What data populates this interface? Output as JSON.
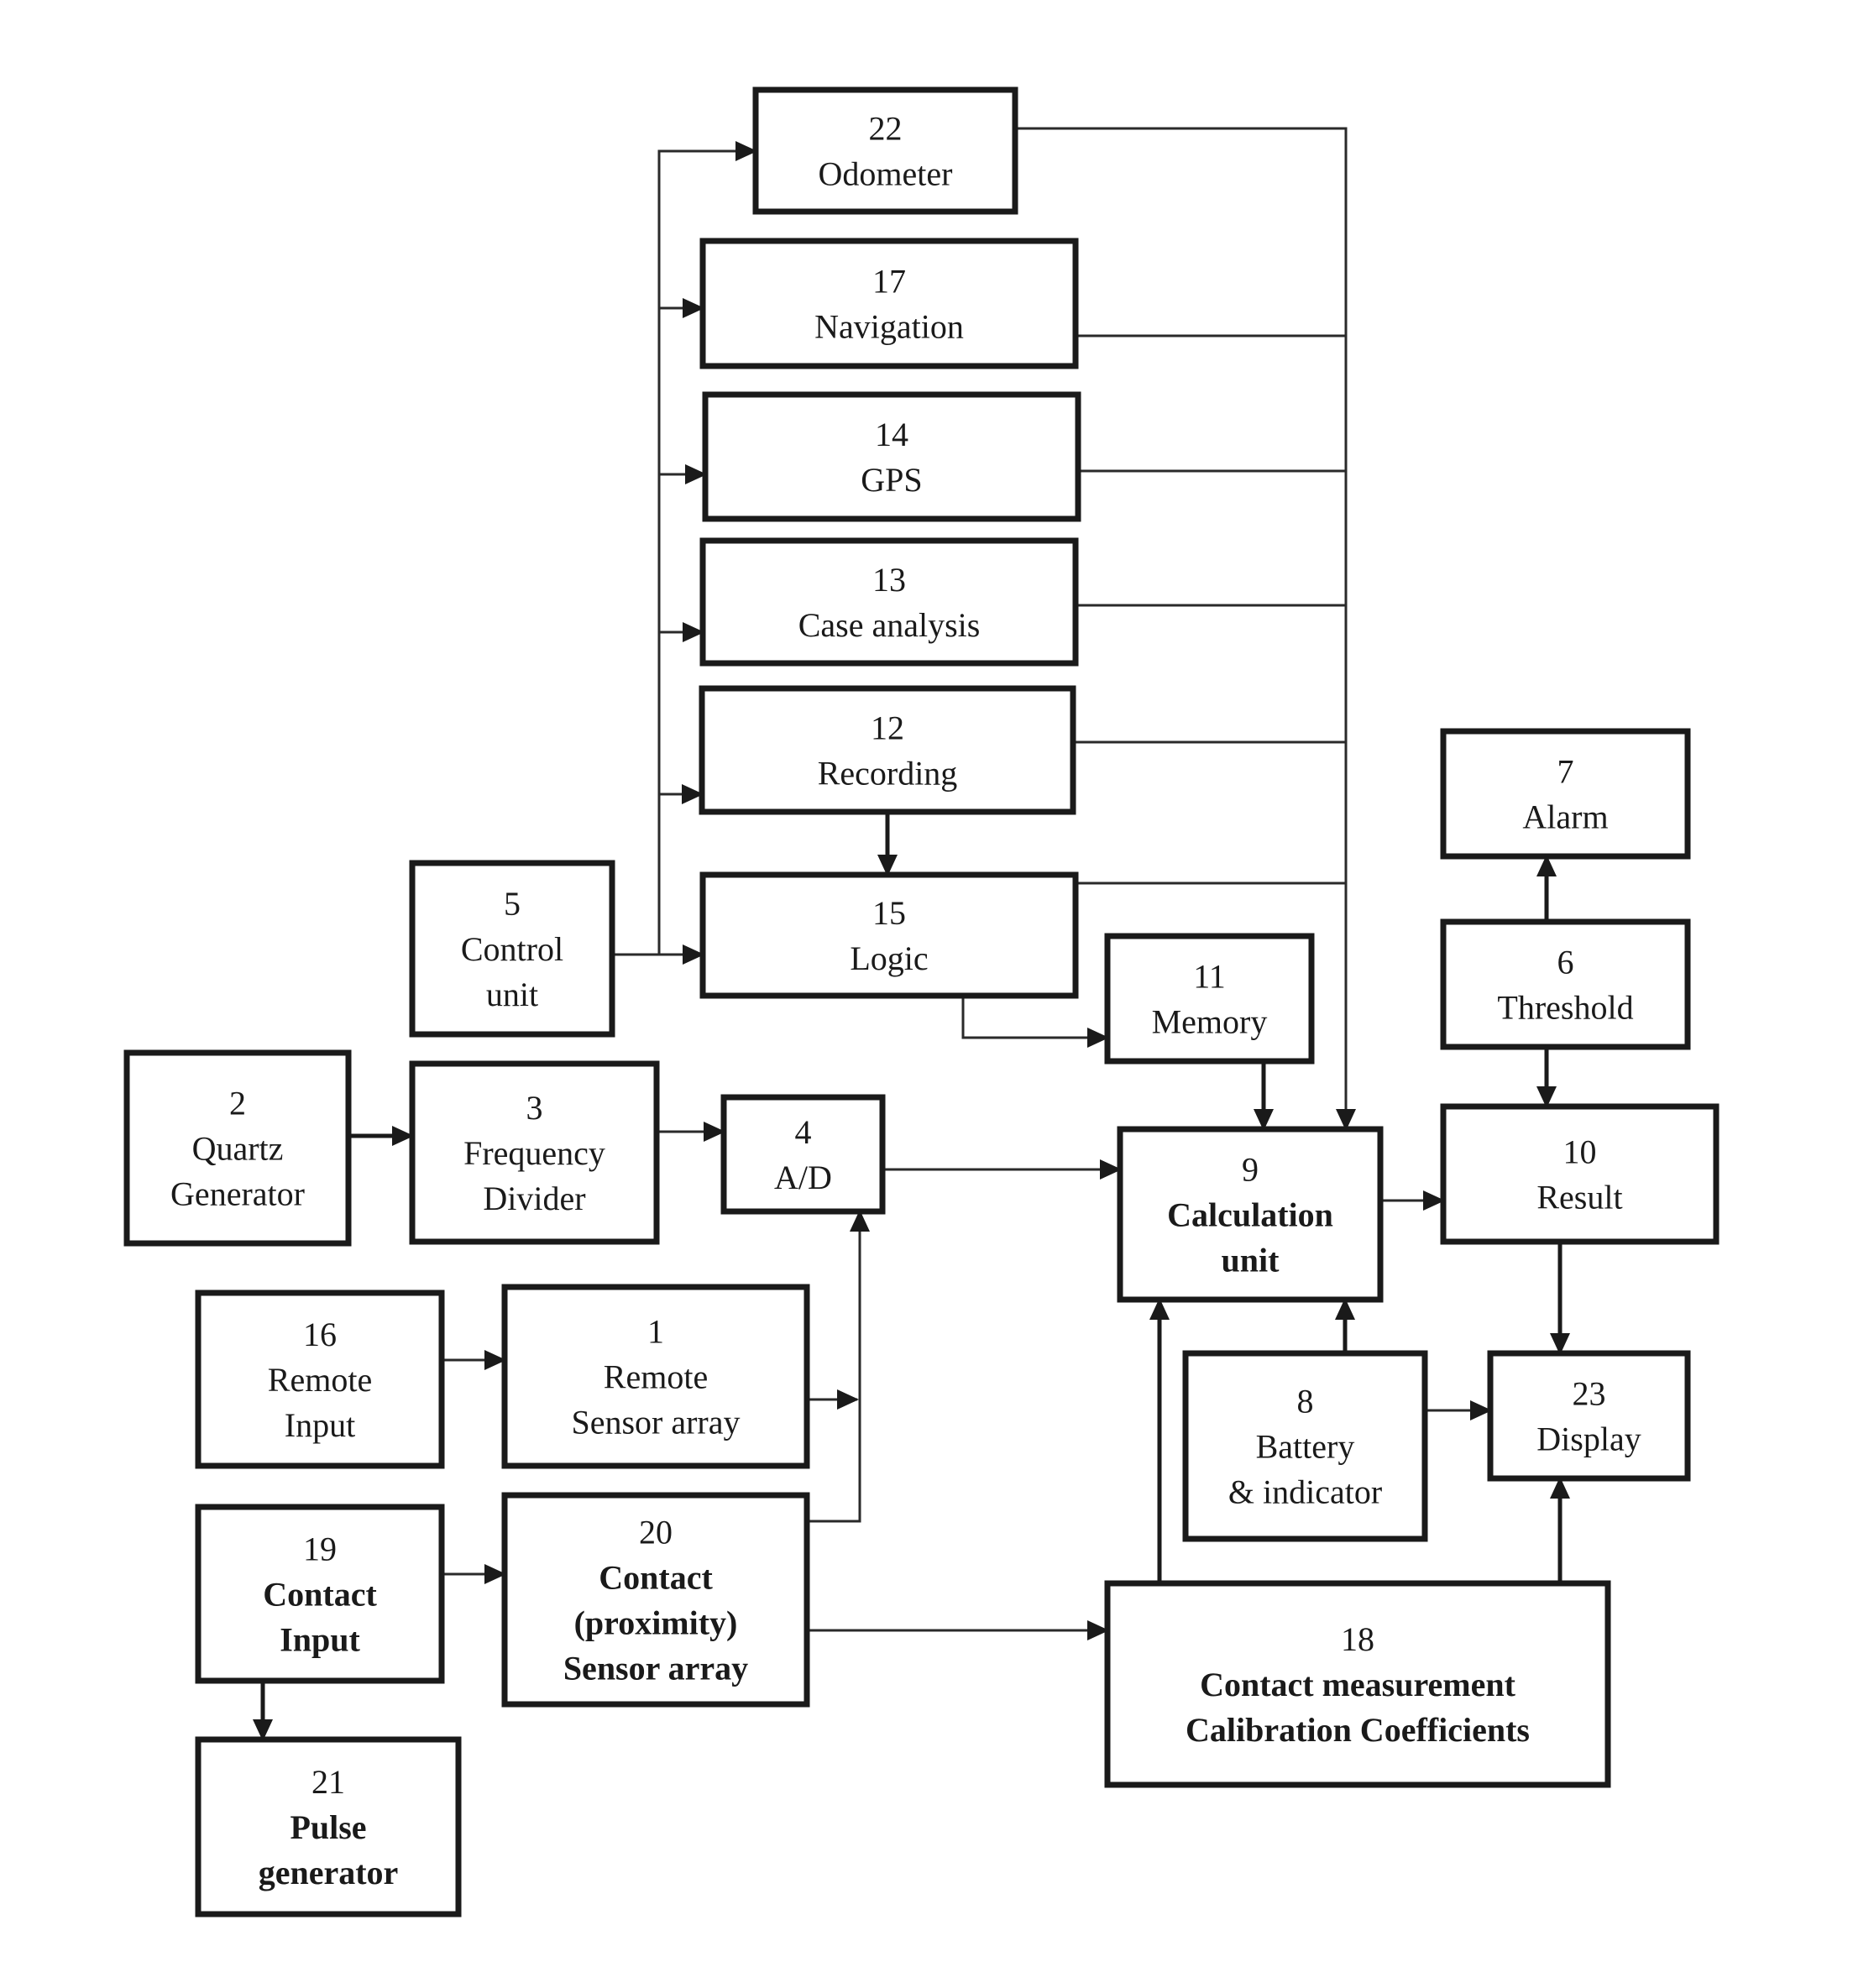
{
  "diagram": {
    "type": "block-diagram",
    "colors": {
      "stroke": "#1a1a1a",
      "background": "#ffffff"
    },
    "blocks": [
      {
        "id": "22",
        "lines": [
          "22",
          "Odometer"
        ],
        "bold": false
      },
      {
        "id": "17",
        "lines": [
          "17",
          "Navigation"
        ],
        "bold": false
      },
      {
        "id": "14",
        "lines": [
          "14",
          "GPS"
        ],
        "bold": false
      },
      {
        "id": "13",
        "lines": [
          "13",
          "Case analysis"
        ],
        "bold": false
      },
      {
        "id": "12",
        "lines": [
          "12",
          "Recording"
        ],
        "bold": false
      },
      {
        "id": "15",
        "lines": [
          "15",
          "Logic"
        ],
        "bold": false
      },
      {
        "id": "5",
        "lines": [
          "5",
          "Control",
          "unit"
        ],
        "bold": false
      },
      {
        "id": "7",
        "lines": [
          "7",
          "Alarm"
        ],
        "bold": false
      },
      {
        "id": "6",
        "lines": [
          "6",
          "Threshold"
        ],
        "bold": false
      },
      {
        "id": "11",
        "lines": [
          "11",
          "Memory"
        ],
        "bold": false
      },
      {
        "id": "2",
        "lines": [
          "2",
          "Quartz",
          "Generator"
        ],
        "bold": false
      },
      {
        "id": "3",
        "lines": [
          "3",
          "Frequency",
          "Divider"
        ],
        "bold": false
      },
      {
        "id": "4",
        "lines": [
          "4",
          "A/D"
        ],
        "bold": false
      },
      {
        "id": "9",
        "lines": [
          "9",
          "Calculation",
          "unit"
        ],
        "bold": true
      },
      {
        "id": "10",
        "lines": [
          "10",
          "Result"
        ],
        "bold": false
      },
      {
        "id": "16",
        "lines": [
          "16",
          "Remote",
          "Input"
        ],
        "bold": false
      },
      {
        "id": "1",
        "lines": [
          "1",
          "Remote",
          "Sensor array"
        ],
        "bold": false
      },
      {
        "id": "19",
        "lines": [
          "19",
          "Contact",
          "Input"
        ],
        "bold": true
      },
      {
        "id": "20",
        "lines": [
          "20",
          "Contact",
          "(proximity)",
          "Sensor array"
        ],
        "bold": true
      },
      {
        "id": "21",
        "lines": [
          "21",
          "Pulse",
          "generator"
        ],
        "bold": true
      },
      {
        "id": "8",
        "lines": [
          "8",
          "Battery",
          "& indicator"
        ],
        "bold": false
      },
      {
        "id": "23",
        "lines": [
          "23",
          "Display"
        ],
        "bold": false
      },
      {
        "id": "18",
        "lines": [
          "18",
          "Contact measurement",
          "Calibration Coefficients"
        ],
        "bold": true
      }
    ],
    "connections": [
      {
        "from": "5",
        "to": "15"
      },
      {
        "from": "5",
        "to": "22"
      },
      {
        "from": "5",
        "to": "17"
      },
      {
        "from": "5",
        "to": "14"
      },
      {
        "from": "5",
        "to": "13"
      },
      {
        "from": "5",
        "to": "12"
      },
      {
        "from": "12",
        "to": "15"
      },
      {
        "from": "22",
        "to": "9"
      },
      {
        "from": "17",
        "to": "9"
      },
      {
        "from": "14",
        "to": "9"
      },
      {
        "from": "13",
        "to": "9"
      },
      {
        "from": "12",
        "to": "9"
      },
      {
        "from": "15",
        "to": "9"
      },
      {
        "from": "15",
        "to": "11"
      },
      {
        "from": "11",
        "to": "9",
        "bidirectional": true
      },
      {
        "from": "2",
        "to": "3",
        "bidirectional": true
      },
      {
        "from": "3",
        "to": "4"
      },
      {
        "from": "4",
        "to": "9"
      },
      {
        "from": "16",
        "to": "1"
      },
      {
        "from": "1",
        "to": "4"
      },
      {
        "from": "20",
        "to": "4"
      },
      {
        "from": "19",
        "to": "20"
      },
      {
        "from": "19",
        "to": "21",
        "bidirectional": true
      },
      {
        "from": "20",
        "to": "18"
      },
      {
        "from": "18",
        "to": "9"
      },
      {
        "from": "18",
        "to": "23"
      },
      {
        "from": "8",
        "to": "9"
      },
      {
        "from": "8",
        "to": "23"
      },
      {
        "from": "9",
        "to": "10"
      },
      {
        "from": "6",
        "to": "7"
      },
      {
        "from": "6",
        "to": "10"
      },
      {
        "from": "10",
        "to": "23"
      }
    ]
  }
}
